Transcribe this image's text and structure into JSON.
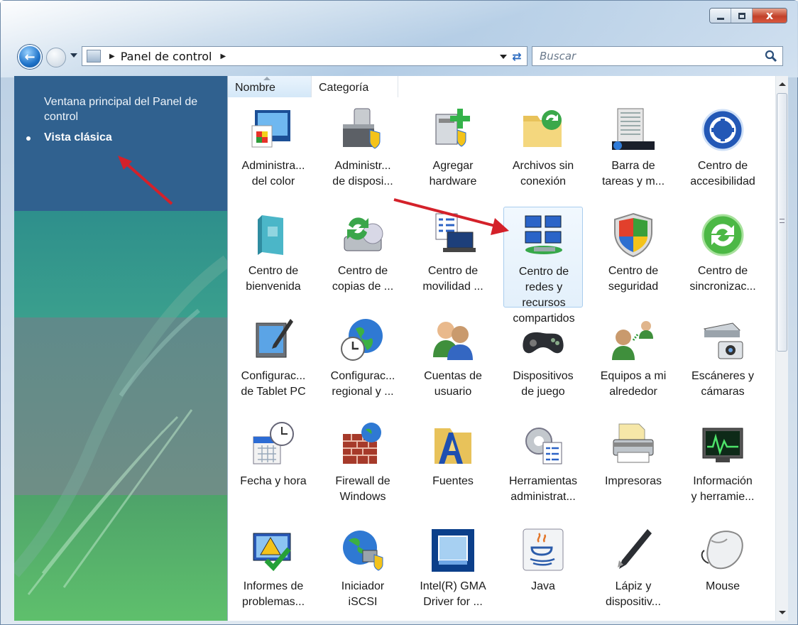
{
  "window": {
    "min_symbol": "",
    "max_symbol": "",
    "close_symbol": "x"
  },
  "nav": {
    "address": "Panel de control",
    "search_placeholder": "Buscar"
  },
  "left_pane": {
    "link_main": "Ventana principal del Panel de control",
    "link_classic": "Vista clásica"
  },
  "columns": [
    {
      "label": "Nombre"
    },
    {
      "label": "Categoría"
    }
  ],
  "items": [
    {
      "label": "Administra...\ndel color",
      "icon": "color-management-icon"
    },
    {
      "label": "Administr...\nde disposi...",
      "icon": "device-manager-icon"
    },
    {
      "label": "Agregar\nhardware",
      "icon": "add-hardware-icon"
    },
    {
      "label": "Archivos sin\nconexión",
      "icon": "offline-files-icon"
    },
    {
      "label": "Barra de\ntareas y m...",
      "icon": "taskbar-icon"
    },
    {
      "label": "Centro de\naccesibilidad",
      "icon": "accessibility-icon"
    },
    {
      "label": "Centro de\nbienvenida",
      "icon": "welcome-center-icon"
    },
    {
      "label": "Centro de\ncopias de ...",
      "icon": "backup-center-icon"
    },
    {
      "label": "Centro de\nmovilidad ...",
      "icon": "mobility-center-icon"
    },
    {
      "label": "Centro de\nredes y\nrecursos\ncompartidos",
      "icon": "network-center-icon"
    },
    {
      "label": "Centro de\nseguridad",
      "icon": "security-center-icon"
    },
    {
      "label": "Centro de\nsincronizac...",
      "icon": "sync-center-icon"
    },
    {
      "label": "Configurac...\nde Tablet PC",
      "icon": "tablet-pc-icon"
    },
    {
      "label": "Configurac...\nregional y ...",
      "icon": "regional-settings-icon"
    },
    {
      "label": "Cuentas de\nusuario",
      "icon": "user-accounts-icon"
    },
    {
      "label": "Dispositivos\nde juego",
      "icon": "game-controllers-icon"
    },
    {
      "label": "Equipos a mi\nalrededor",
      "icon": "people-near-me-icon"
    },
    {
      "label": "Escáneres y\ncámaras",
      "icon": "scanners-cameras-icon"
    },
    {
      "label": "Fecha y hora",
      "icon": "date-time-icon"
    },
    {
      "label": "Firewall de\nWindows",
      "icon": "firewall-icon"
    },
    {
      "label": "Fuentes",
      "icon": "fonts-icon"
    },
    {
      "label": "Herramientas\nadministrat...",
      "icon": "admin-tools-icon"
    },
    {
      "label": "Impresoras",
      "icon": "printers-icon"
    },
    {
      "label": "Información\ny herramie...",
      "icon": "performance-info-icon"
    },
    {
      "label": "Informes de\nproblemas...",
      "icon": "problem-reports-icon"
    },
    {
      "label": "Iniciador\niSCSI",
      "icon": "iscsi-icon"
    },
    {
      "label": "Intel(R) GMA\nDriver for ...",
      "icon": "intel-gma-icon"
    },
    {
      "label": "Java",
      "icon": "java-icon"
    },
    {
      "label": "Lápiz y\ndispositiv...",
      "icon": "pen-input-icon"
    },
    {
      "label": "Mouse",
      "icon": "mouse-icon"
    }
  ]
}
